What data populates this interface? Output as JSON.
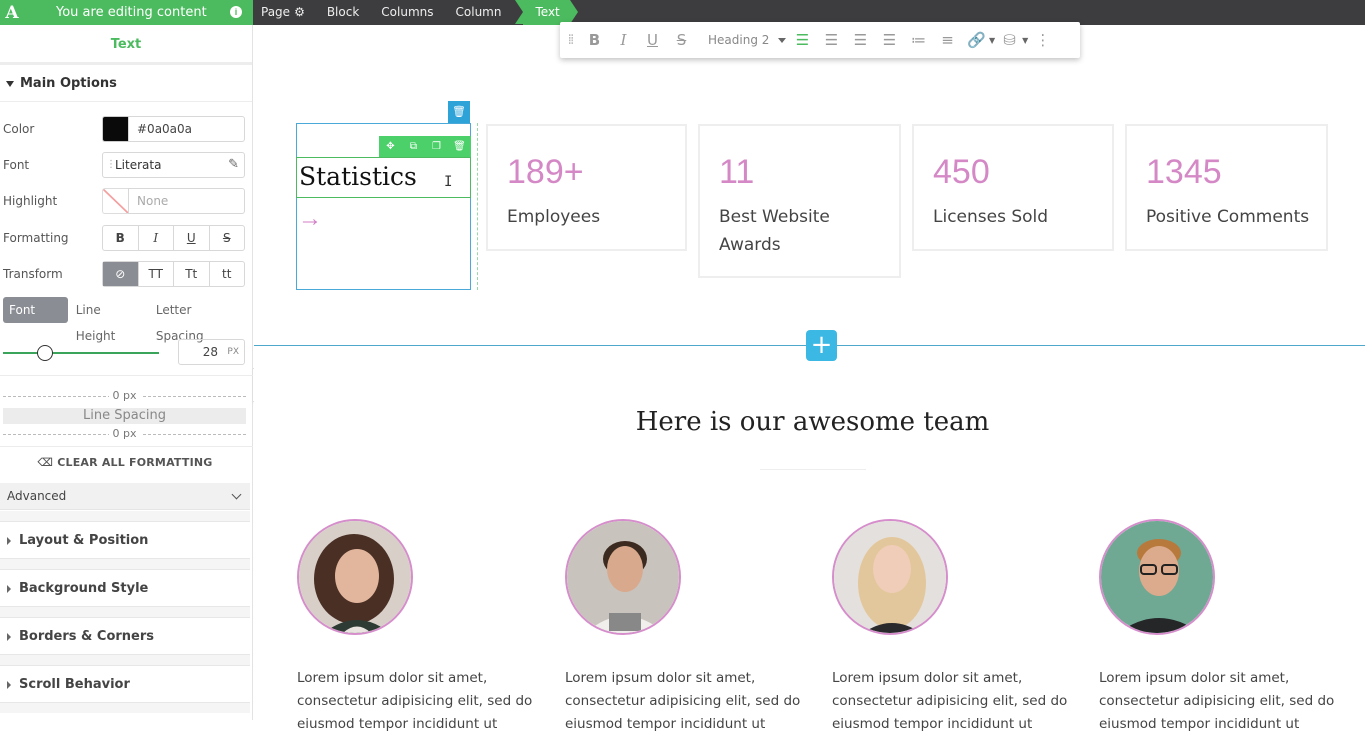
{
  "topbar": {
    "brand_logo": "A",
    "editing_label": "You are editing content",
    "info_icon": "i",
    "crumbs": [
      "Page",
      "Block",
      "Columns",
      "Column",
      "Text"
    ],
    "accent_color": "#4cbb5f"
  },
  "sidebar": {
    "title": "Text",
    "main_options_label": "Main Options",
    "color_label": "Color",
    "color_value": "#0a0a0a",
    "font_label": "Font",
    "font_value": "Literata",
    "highlight_label": "Highlight",
    "highlight_value": "None",
    "formatting_label": "Formatting",
    "formatting_buttons": [
      "B",
      "I",
      "U",
      "S"
    ],
    "transform_label": "Transform",
    "transform_buttons": [
      "⊘",
      "TT",
      "Tt",
      "tt"
    ],
    "size_tabs": [
      "Font Size",
      "Line Height",
      "Letter Spacing"
    ],
    "font_size_value": "28",
    "font_size_unit": "PX",
    "font_size_slider_fraction": 0.27,
    "spacing_top": "0 px",
    "spacing_label": "Line Spacing",
    "spacing_bottom": "0 px",
    "clear_formatting": "CLEAR ALL FORMATTING",
    "advanced_label": "Advanced",
    "accordions": [
      "Layout & Position",
      "Background Style",
      "Borders & Corners",
      "Scroll Behavior"
    ]
  },
  "toolbar": {
    "heading_select": "Heading 2"
  },
  "stats": {
    "heading": "Statistics",
    "arrow": "→",
    "cards": [
      {
        "number": "189+",
        "label": "Employees"
      },
      {
        "number": "11",
        "label": "Best Website Awards"
      },
      {
        "number": "450",
        "label": "Licenses Sold"
      },
      {
        "number": "1345",
        "label": "Positive Comments"
      }
    ],
    "number_color": "#d488c6"
  },
  "add_button": "+",
  "team": {
    "title": "Here is our awesome team",
    "members": [
      {
        "text": "Lorem ipsum dolor sit amet, consectetur adipisicing elit, sed do eiusmod tempor incididunt ut"
      },
      {
        "text": "Lorem ipsum dolor sit amet, consectetur adipisicing elit, sed do eiusmod tempor incididunt ut"
      },
      {
        "text": "Lorem ipsum dolor sit amet, consectetur adipisicing elit, sed do eiusmod tempor incididunt ut"
      },
      {
        "text": "Lorem ipsum dolor sit amet, consectetur adipisicing elit, sed do eiusmod tempor incididunt ut"
      }
    ]
  }
}
